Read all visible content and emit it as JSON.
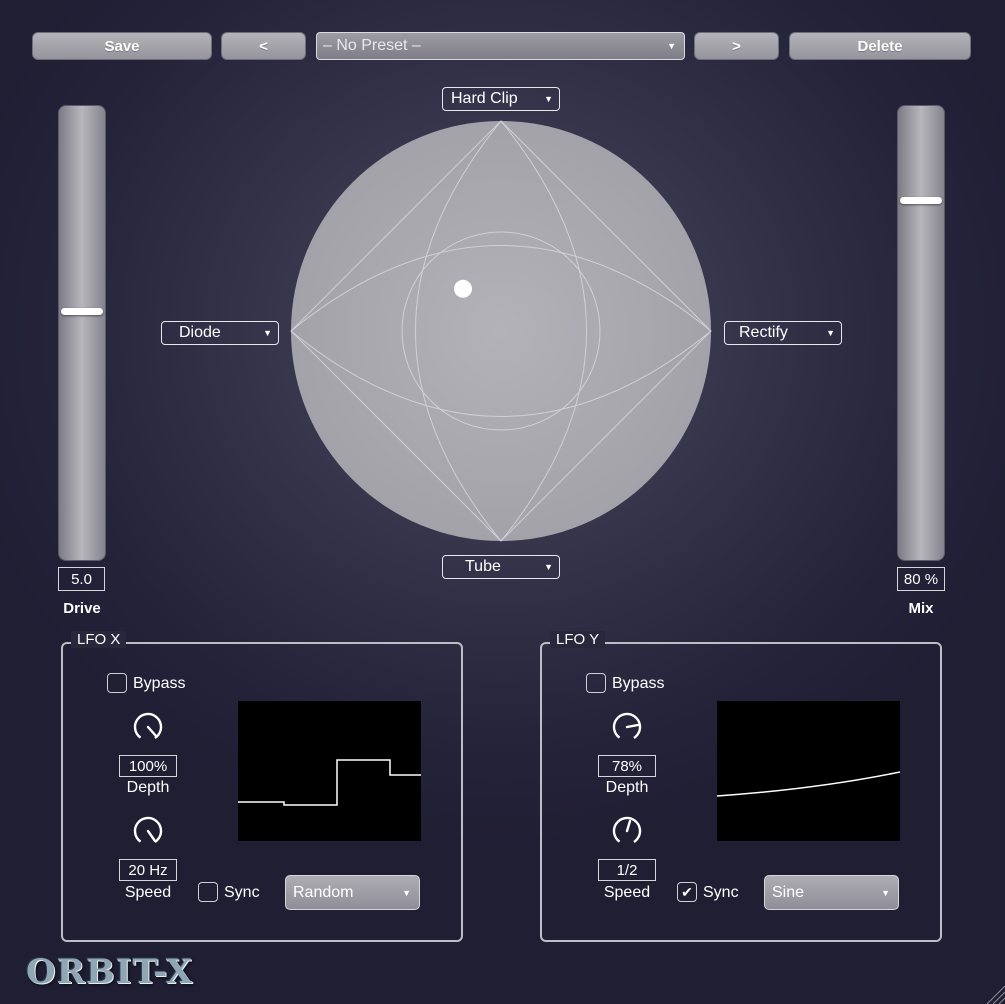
{
  "toolbar": {
    "save_label": "Save",
    "prev_label": "<",
    "preset_value": "– No Preset –",
    "next_label": ">",
    "delete_label": "Delete"
  },
  "pad": {
    "top_mode": "Hard Clip",
    "bottom_mode": "Tube",
    "left_mode": "Diode",
    "right_mode": "Rectify",
    "dot_x": 0.41,
    "dot_y": 0.4
  },
  "drive": {
    "value": "5.0",
    "label": "Drive",
    "level": 0.55
  },
  "mix": {
    "value": "80 %",
    "label": "Mix",
    "level": 0.8
  },
  "lfo_x": {
    "title": "LFO X",
    "bypass_label": "Bypass",
    "bypass_checked": false,
    "depth_value": "100%",
    "depth_label": "Depth",
    "speed_value": "20 Hz",
    "speed_label": "Speed",
    "sync_label": "Sync",
    "sync_checked": false,
    "waveform": "Random"
  },
  "lfo_y": {
    "title": "LFO Y",
    "bypass_label": "Bypass",
    "bypass_checked": false,
    "depth_value": "78%",
    "depth_label": "Depth",
    "speed_value": "1/2",
    "speed_label": "Speed",
    "sync_label": "Sync",
    "sync_checked": true,
    "sync_mark": "✔",
    "waveform": "Sine"
  },
  "logo_text": "ORBIT-X",
  "icons": {
    "dropdown": "caret-down-icon",
    "check": "checkmark-icon",
    "resize": "resize-grip-icon"
  }
}
